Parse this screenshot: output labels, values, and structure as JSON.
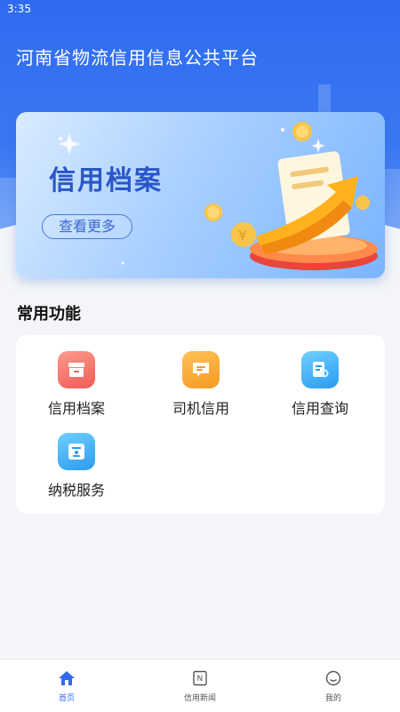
{
  "status_bar": {
    "time": "3:35"
  },
  "header": {
    "title": "河南省物流信用信息公共平台"
  },
  "banner": {
    "title": "信用档案",
    "button_label": "查看更多"
  },
  "section": {
    "title": "常用功能"
  },
  "functions": [
    {
      "label": "信用档案",
      "icon": "archive-icon",
      "color": "#ef5b55"
    },
    {
      "label": "司机信用",
      "icon": "message-icon",
      "color": "#f59a1f"
    },
    {
      "label": "信用查询",
      "icon": "document-search-icon",
      "color": "#2a9bf0"
    },
    {
      "label": "纳税服务",
      "icon": "id-card-icon",
      "color": "#2a9bf0"
    }
  ],
  "tabbar": {
    "items": [
      {
        "label": "首页",
        "icon": "home-icon",
        "active": true
      },
      {
        "label": "信用新闻",
        "icon": "news-icon",
        "active": false
      },
      {
        "label": "我的",
        "icon": "profile-icon",
        "active": false
      }
    ],
    "active_color": "#2f6bf0"
  }
}
